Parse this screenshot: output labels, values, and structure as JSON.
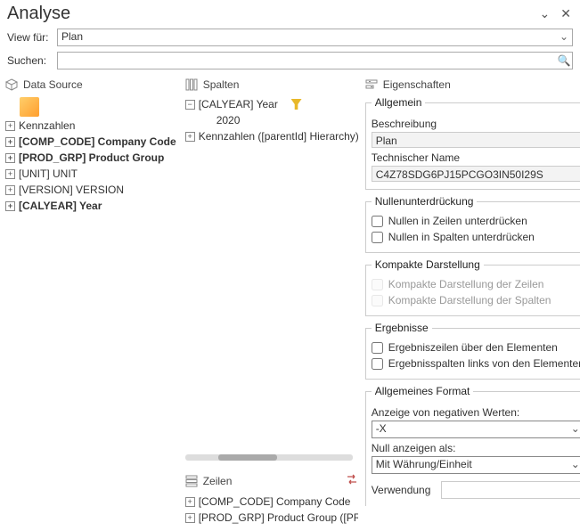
{
  "window": {
    "title": "Analyse"
  },
  "toolbar": {
    "viewfuer_label": "View für:",
    "viewfuer_value": "Plan",
    "suchen_label": "Suchen:"
  },
  "sections": {
    "datasource": "Data Source",
    "spalten": "Spalten",
    "zeilen": "Zeilen",
    "eigenschaften": "Eigenschaften"
  },
  "datasource": {
    "items": [
      {
        "label": "Kennzahlen",
        "bold": false
      },
      {
        "label": "[COMP_CODE] Company Code",
        "bold": true
      },
      {
        "label": "[PROD_GRP] Product Group",
        "bold": true
      },
      {
        "label": "[UNIT] UNIT",
        "bold": false
      },
      {
        "label": "[VERSION] VERSION",
        "bold": false
      },
      {
        "label": "[CALYEAR] Year",
        "bold": true
      }
    ]
  },
  "spalten": {
    "items": [
      {
        "label": "[CALYEAR] Year",
        "expanded": true,
        "filter": true
      },
      {
        "label": "2020",
        "child": true
      },
      {
        "label": "Kennzahlen ([parentId] Hierarchy)",
        "filter": true
      }
    ]
  },
  "zeilen": {
    "items": [
      {
        "label": "[COMP_CODE] Company Code"
      },
      {
        "label": "[PROD_GRP] Product Group ([PROD_G"
      }
    ]
  },
  "props": {
    "allgemein": {
      "legend": "Allgemein",
      "beschreibung_label": "Beschreibung",
      "beschreibung_value": "Plan",
      "technischer_label": "Technischer Name",
      "technischer_value": "C4Z78SDG6PJ15PCGO3IN50I29S"
    },
    "nullen": {
      "legend": "Nullenunterdrückung",
      "zeilen": "Nullen in Zeilen unterdrücken",
      "spalten": "Nullen in Spalten unterdrücken"
    },
    "kompakt": {
      "legend": "Kompakte Darstellung",
      "zeilen": "Kompakte Darstellung der Zeilen",
      "spalten": "Kompakte Darstellung der Spalten"
    },
    "ergebnisse": {
      "legend": "Ergebnisse",
      "zeilen": "Ergebniszeilen über den Elementen",
      "spalten": "Ergebnisspalten links von den Elementen"
    },
    "format": {
      "legend": "Allgemeines Format",
      "neg_label": "Anzeige von negativen Werten:",
      "neg_value": "-X",
      "null_label": "Null anzeigen als:",
      "null_value": "Mit Währung/Einheit",
      "verwendung_label": "Verwendung"
    }
  }
}
